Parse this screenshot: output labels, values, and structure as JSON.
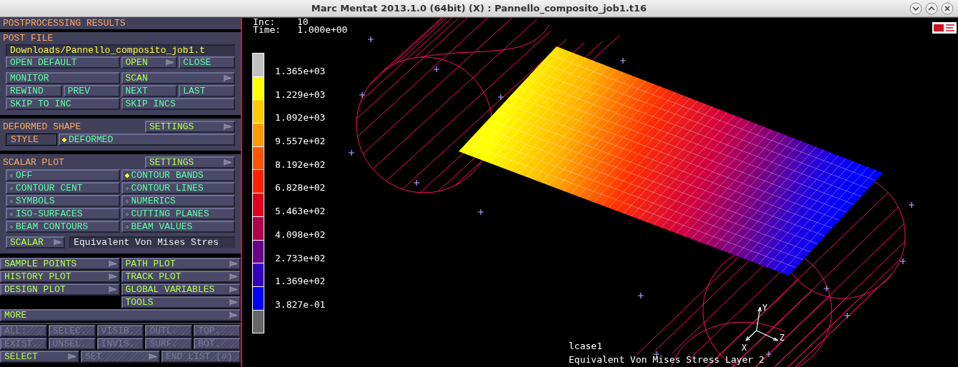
{
  "window": {
    "title": "Marc Mentat 2013.1.0 (64bit) (X) : Pannello_composito_job1.t16"
  },
  "panel": {
    "title": "POSTPROCESSING RESULTS",
    "sections": [
      {
        "title": "POST FILE",
        "file_field": {
          "value": "Downloads/Pannello_composito_job1.t"
        },
        "row_groups": [
          [
            {
              "left": [
                {
                  "label": "OPEN DEFAULT",
                  "kind": "action"
                }
              ],
              "right": [
                {
                  "label": "OPEN",
                  "kind": "menu"
                },
                {
                  "label": "CLOSE",
                  "kind": "action"
                }
              ]
            }
          ],
          [
            {
              "left": [
                {
                  "label": "MONITOR",
                  "kind": "action"
                }
              ],
              "right": [
                {
                  "label": "SCAN",
                  "kind": "menu"
                }
              ]
            },
            {
              "left": [
                {
                  "label": "REWIND",
                  "kind": "action"
                },
                {
                  "label": "PREV",
                  "kind": "action"
                }
              ],
              "right": [
                {
                  "label": "NEXT",
                  "kind": "action"
                },
                {
                  "label": "LAST",
                  "kind": "action"
                }
              ]
            },
            {
              "left": [
                {
                  "label": "SKIP TO INC",
                  "kind": "action"
                }
              ],
              "right": [
                {
                  "label": "SKIP INCS",
                  "kind": "action"
                }
              ]
            }
          ]
        ]
      },
      {
        "title": "DEFORMED SHAPE",
        "settings": {
          "label": "SETTINGS",
          "kind": "menu"
        },
        "row_groups": [
          [
            {
              "items": [
                {
                  "label": "STYLE",
                  "kind": "tag"
                },
                {
                  "label": "DEFORMED",
                  "kind": "radio",
                  "selected": true
                }
              ]
            }
          ]
        ]
      },
      {
        "title": "SCALAR PLOT",
        "settings": {
          "label": "SETTINGS",
          "kind": "menu"
        },
        "row_groups": [
          [
            {
              "left": [
                {
                  "label": "OFF",
                  "kind": "radio",
                  "selected": false
                }
              ],
              "right": [
                {
                  "label": "CONTOUR BANDS",
                  "kind": "radio",
                  "selected": true
                }
              ]
            },
            {
              "left": [
                {
                  "label": "CONTOUR CENT",
                  "kind": "radio",
                  "selected": false
                }
              ],
              "right": [
                {
                  "label": "CONTOUR LINES",
                  "kind": "radio",
                  "selected": false
                }
              ]
            },
            {
              "left": [
                {
                  "label": "SYMBOLS",
                  "kind": "radio",
                  "selected": false
                }
              ],
              "right": [
                {
                  "label": "NUMERICS",
                  "kind": "radio",
                  "selected": false
                }
              ]
            },
            {
              "left": [
                {
                  "label": "ISO-SURFACES",
                  "kind": "radio",
                  "selected": false
                }
              ],
              "right": [
                {
                  "label": "CUTTING PLANES",
                  "kind": "radio",
                  "selected": false
                }
              ]
            },
            {
              "left": [
                {
                  "label": "BEAM CONTOURS",
                  "kind": "radio",
                  "selected": false
                }
              ],
              "right": [
                {
                  "label": "BEAM VALUES",
                  "kind": "radio",
                  "selected": false
                }
              ]
            }
          ],
          [
            {
              "items": [
                {
                  "label": "SCALAR",
                  "kind": "menu"
                },
                {
                  "value": "Equivalent Von Mises Stres",
                  "kind": "field"
                }
              ]
            }
          ]
        ]
      }
    ],
    "plot_menus": [
      {
        "left": [
          {
            "label": "SAMPLE POINTS",
            "kind": "menu"
          }
        ],
        "right": [
          {
            "label": "PATH PLOT",
            "kind": "menu"
          }
        ]
      },
      {
        "left": [
          {
            "label": "HISTORY PLOT",
            "kind": "menu"
          }
        ],
        "right": [
          {
            "label": "TRACK PLOT",
            "kind": "menu"
          }
        ]
      },
      {
        "left": [
          {
            "label": "DESIGN PLOT",
            "kind": "menu"
          }
        ],
        "right": [
          {
            "label": "GLOBAL VARIABLES",
            "kind": "menu"
          }
        ]
      },
      {
        "right": [
          {
            "label": "TOOLS",
            "kind": "menu"
          }
        ]
      },
      {
        "items": [
          {
            "label": "MORE",
            "kind": "menu"
          }
        ]
      }
    ],
    "selection": [
      [
        {
          "label": "ALL:",
          "kind": "action",
          "disabled": true
        },
        {
          "label": "SELEC.",
          "kind": "action",
          "disabled": true
        },
        {
          "label": "VISIB.",
          "kind": "action",
          "disabled": true
        },
        {
          "label": "OUTL.",
          "kind": "action",
          "disabled": true
        },
        {
          "label": "TOP.",
          "kind": "action",
          "disabled": true
        }
      ],
      [
        {
          "label": "EXIST.",
          "kind": "action",
          "disabled": true
        },
        {
          "label": "UNSEL.",
          "kind": "action",
          "disabled": true
        },
        {
          "label": "INVIS.",
          "kind": "action",
          "disabled": true
        },
        {
          "label": "SURF.",
          "kind": "action",
          "disabled": true
        },
        {
          "label": "BOT.",
          "kind": "action",
          "disabled": true
        }
      ],
      [
        {
          "label": "SELECT",
          "kind": "menu",
          "disabled": false
        },
        {
          "label": "SET",
          "kind": "menu",
          "disabled": true
        },
        {
          "label": "END LIST (#)",
          "kind": "action",
          "disabled": true
        }
      ]
    ]
  },
  "viewport": {
    "inc_label": "Inc:",
    "inc_value": "10",
    "time_label": "Time:",
    "time_value": "1.000e+00",
    "legend": {
      "bands": [
        {
          "color": "#c0c0c0"
        },
        {
          "color": "#ffff00"
        },
        {
          "color": "#ffcc00"
        },
        {
          "color": "#ff9900"
        },
        {
          "color": "#ff5500"
        },
        {
          "color": "#ff2200"
        },
        {
          "color": "#e00020"
        },
        {
          "color": "#b00050"
        },
        {
          "color": "#680088"
        },
        {
          "color": "#3300c0"
        },
        {
          "color": "#0000ff"
        },
        {
          "color": "#666666"
        }
      ],
      "labels": [
        "1.365e+03",
        "1.229e+03",
        "1.092e+03",
        "9.557e+02",
        "8.192e+02",
        "6.828e+02",
        "5.463e+02",
        "4.098e+02",
        "2.733e+02",
        "1.369e+02",
        "3.827e-01"
      ]
    },
    "triad": {
      "x": "X",
      "y": "Y",
      "z": "Z"
    },
    "load_case": "lcase1",
    "result_name": "Equivalent Von Mises Stress Layer 2"
  }
}
